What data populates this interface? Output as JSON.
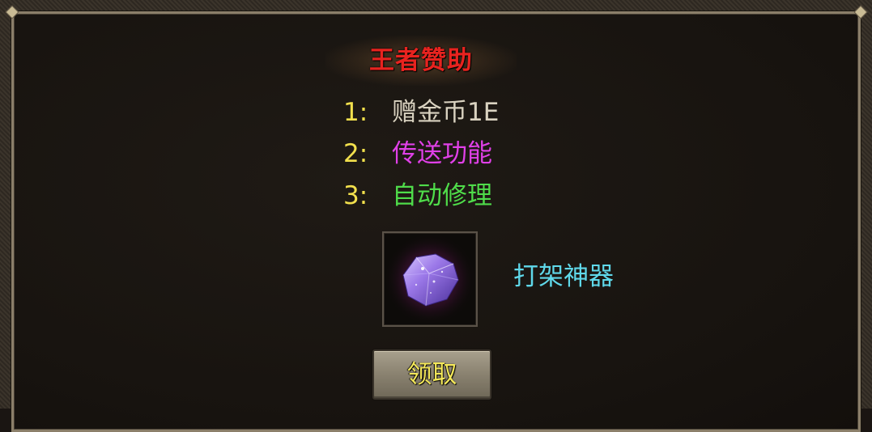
{
  "panel": {
    "title": "王者赞助",
    "title_color": "#e8231f"
  },
  "benefits": [
    {
      "number": "1:",
      "text": "赠金币1E",
      "color": "#d9d2c0"
    },
    {
      "number": "2:",
      "text": "传送功能",
      "color": "#e040e8"
    },
    {
      "number": "3:",
      "text": "自动修理",
      "color": "#4fdc4a"
    }
  ],
  "reward": {
    "icon": "purple-crystal-icon",
    "name": "打架神器",
    "name_color": "#5fd8ea"
  },
  "claim_button": {
    "label": "领取",
    "label_color": "#f4e85a"
  }
}
